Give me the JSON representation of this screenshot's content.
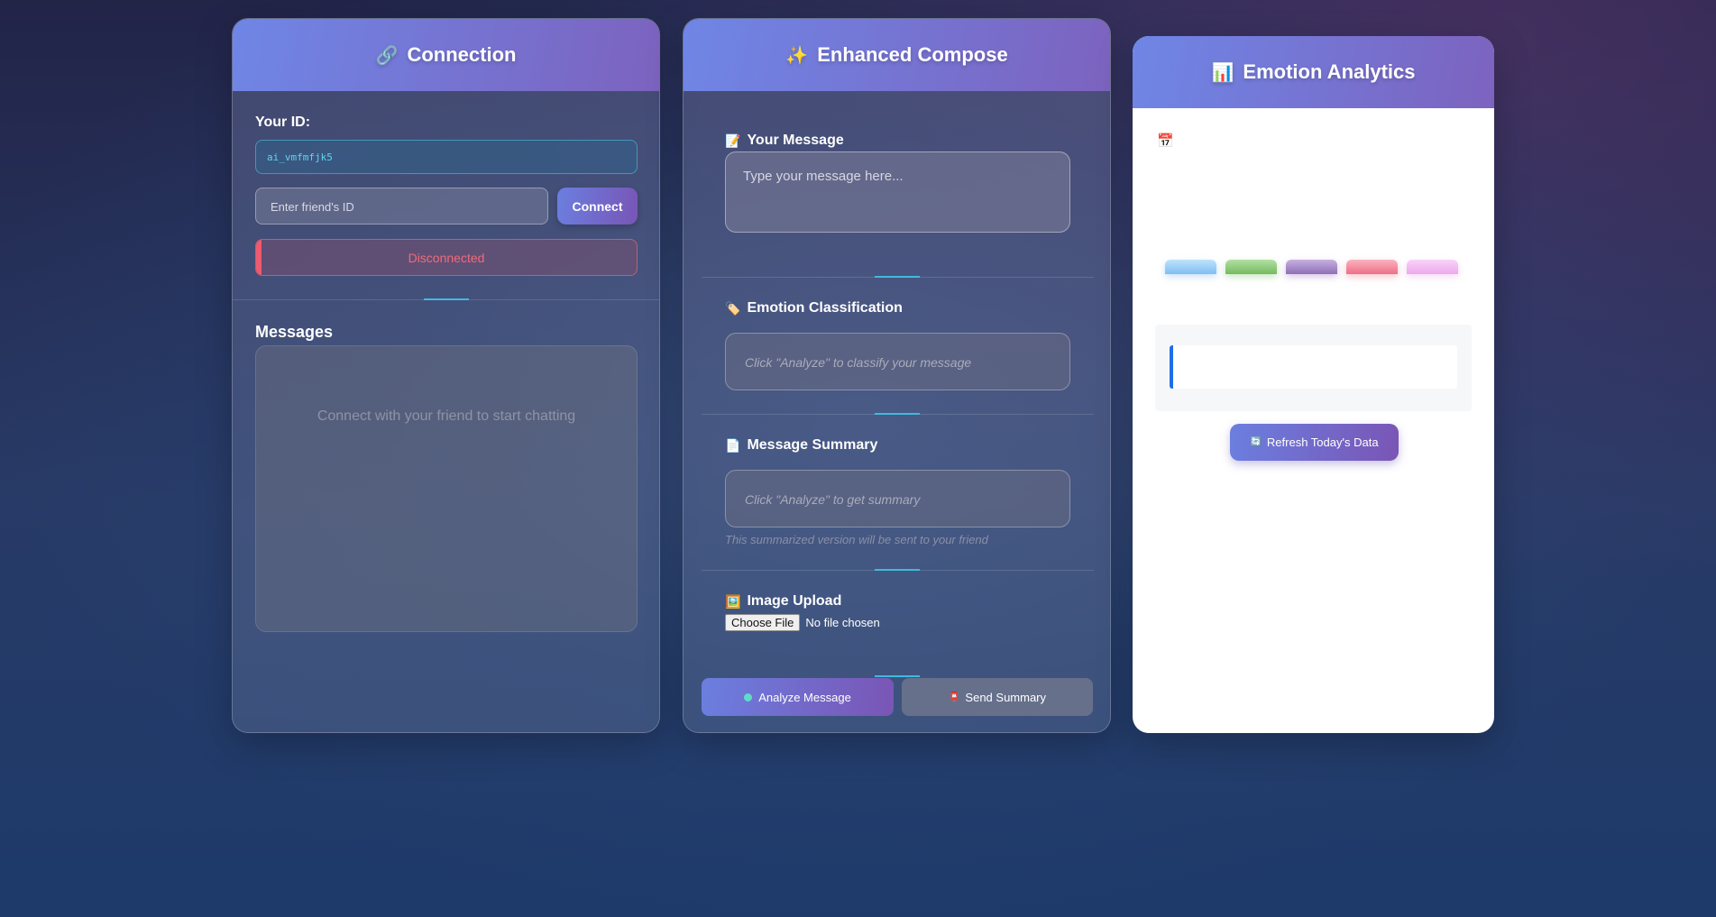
{
  "connection": {
    "title": "Connection",
    "icon": "link-icon",
    "your_id_label": "Your ID:",
    "your_id_value": "ai_vmfmfjk5",
    "friend_id_placeholder": "Enter friend's ID",
    "connect_label": "Connect",
    "status_text": "Disconnected",
    "messages_heading": "Messages",
    "messages_empty": "Connect with your friend to start chatting"
  },
  "compose": {
    "title": "Enhanced Compose",
    "icon": "sparkles-icon",
    "your_message_label": "Your Message",
    "message_placeholder": "Type your message here...",
    "emotion_label": "Emotion Classification",
    "emotion_placeholder": "Click \"Analyze\" to classify your message",
    "summary_label": "Message Summary",
    "summary_placeholder": "Click \"Analyze\" to get summary",
    "summary_hint": "This summarized version will be sent to your friend",
    "image_upload_label": "Image Upload",
    "choose_file_label": "Choose File",
    "no_file_text": "No file chosen",
    "analyze_label": "Analyze Message",
    "send_label": "Send Summary"
  },
  "analytics": {
    "title": "Emotion Analytics",
    "icon": "bar-chart-icon",
    "refresh_label": "Refresh Today's Data",
    "bar_colors": [
      "#9fd0f7",
      "#8fcd7e",
      "#a88bc8",
      "#f58fa0",
      "#f3b8f3"
    ]
  },
  "colors": {
    "accent_start": "#6f86e6",
    "accent_end": "#7c63bf",
    "status_red": "#f26a7a",
    "id_cyan": "#5fd6ef",
    "divider_accent": "#41b9de"
  }
}
